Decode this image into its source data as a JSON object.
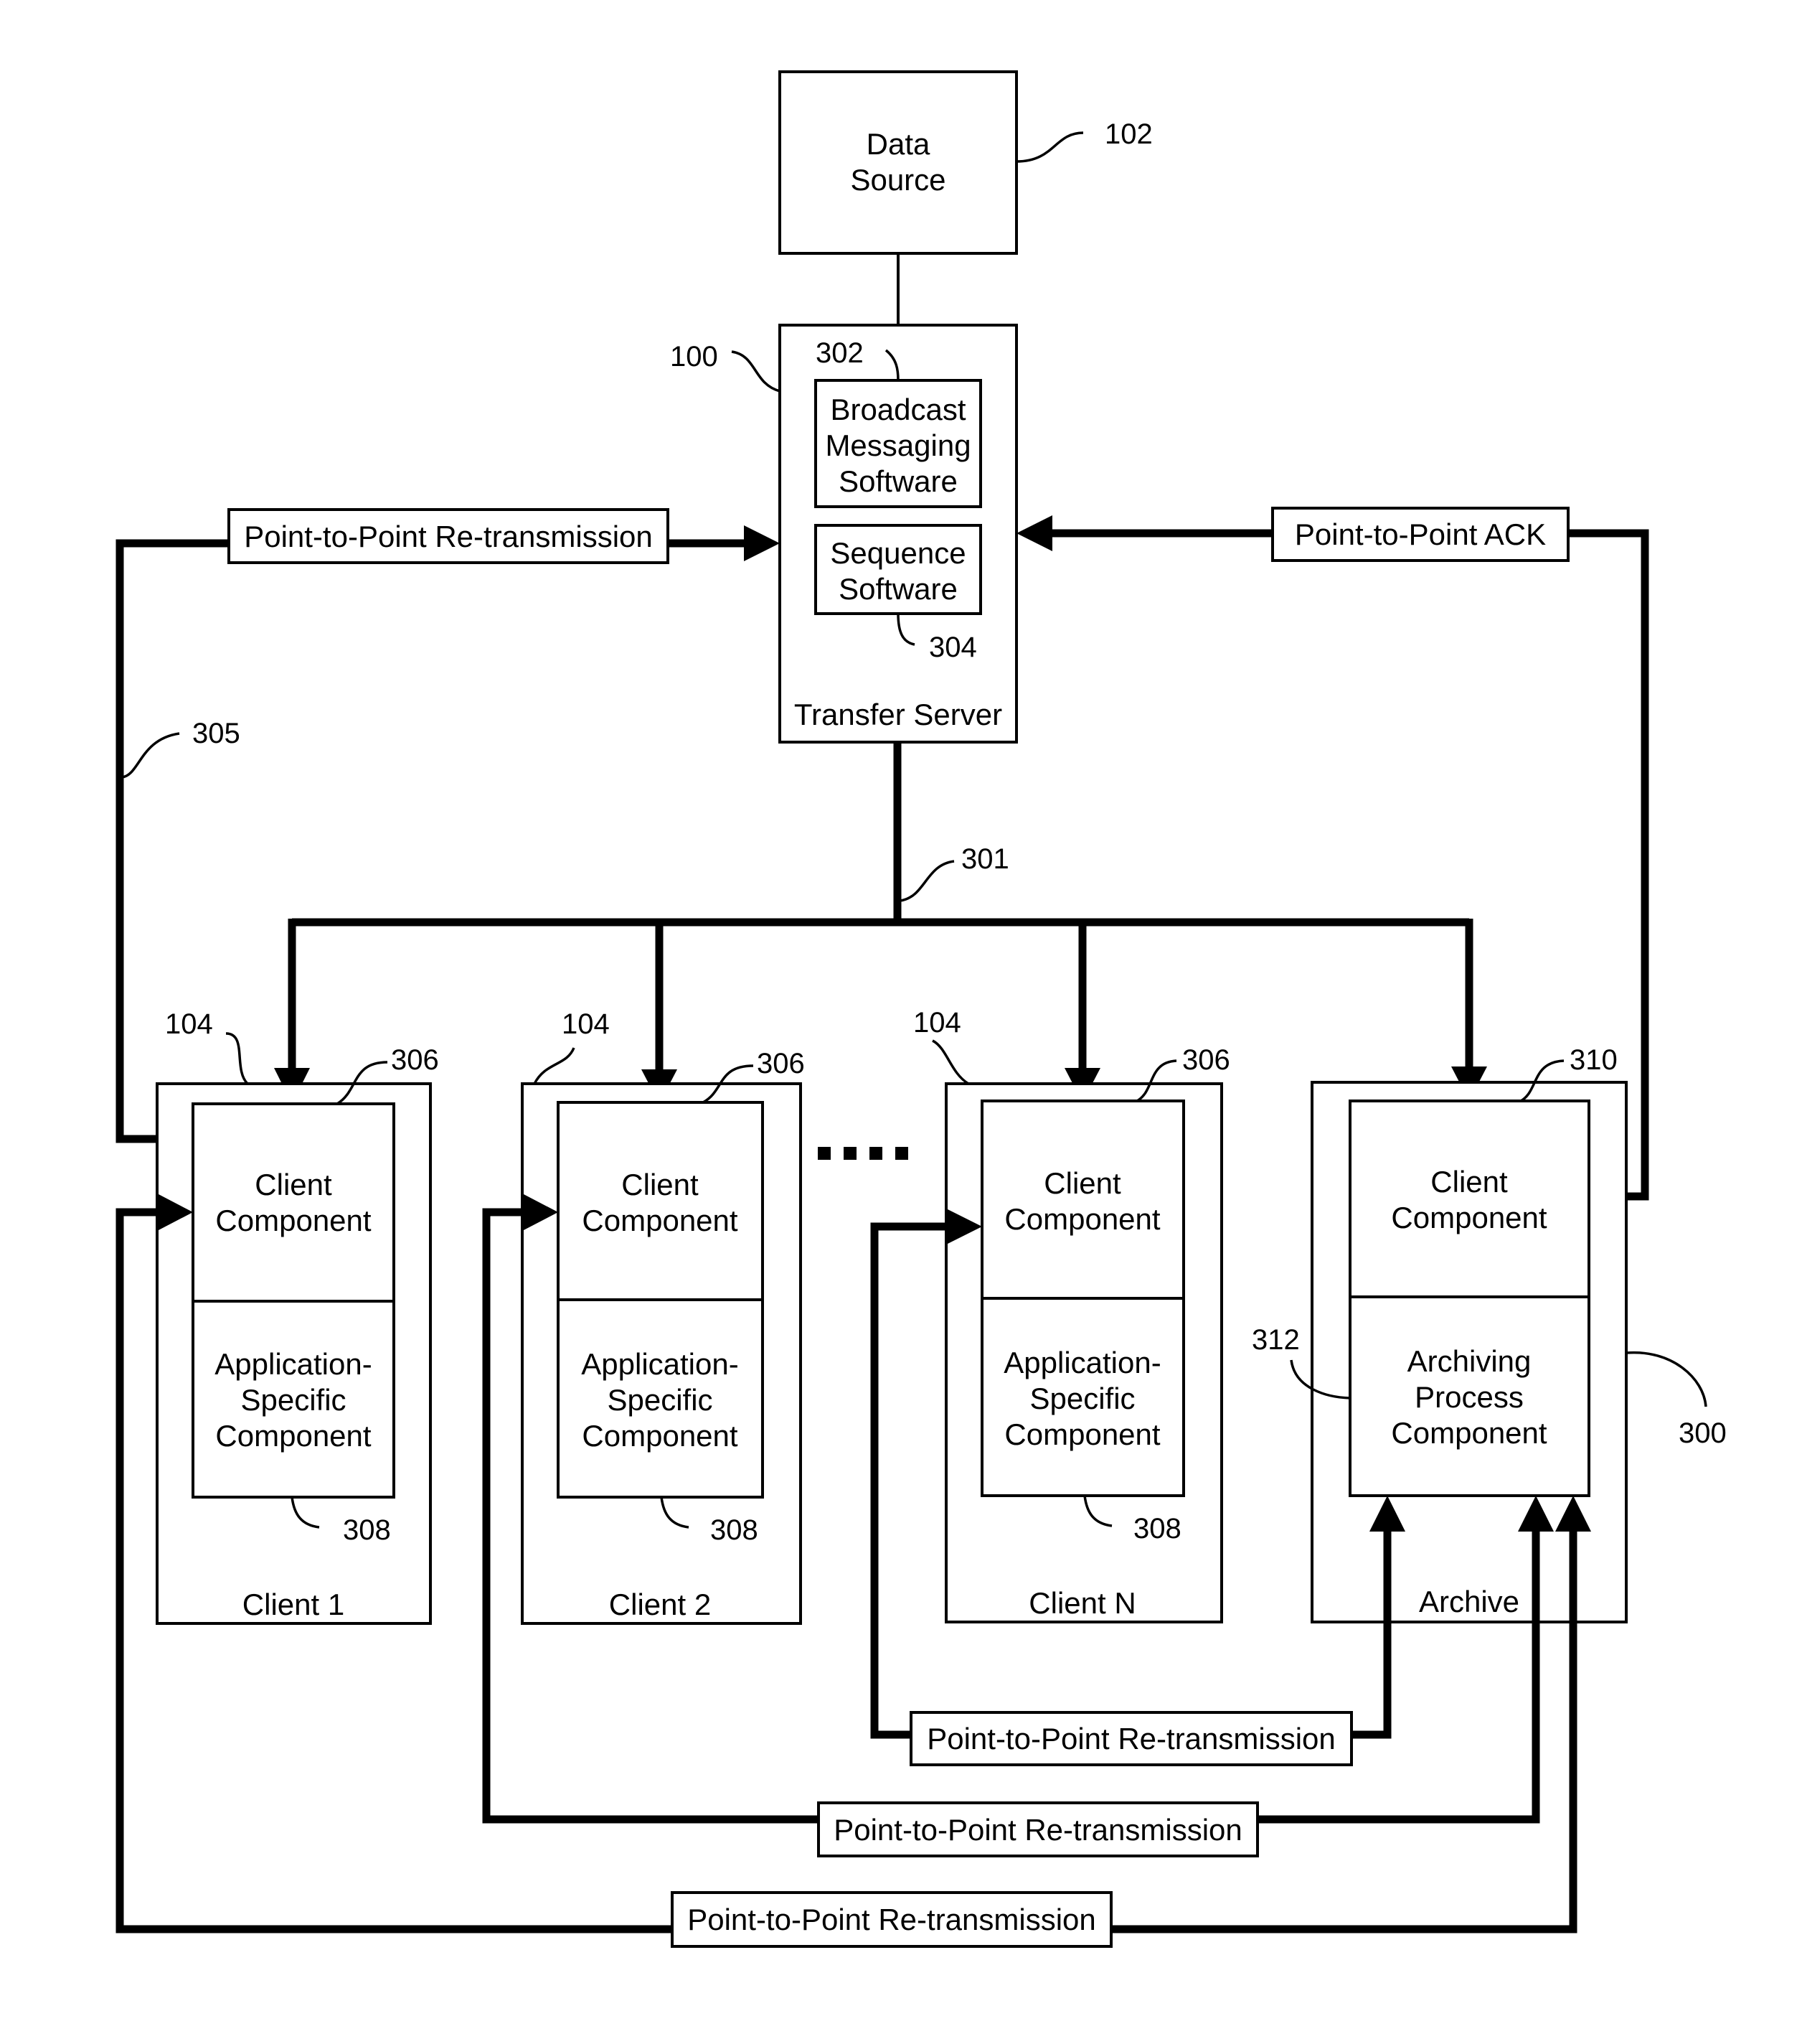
{
  "diagram": {
    "data_source": {
      "lines": [
        "Data",
        "Source"
      ],
      "ref": "102"
    },
    "transfer_server": {
      "title": "Transfer Server",
      "ref": "100",
      "broadcast": {
        "lines": [
          "Broadcast",
          "Messaging",
          "Software"
        ],
        "ref": "302"
      },
      "sequence": {
        "lines": [
          "Sequence",
          "Software"
        ],
        "ref": "304"
      }
    },
    "bus_ref": "301",
    "retrans_path_ref": "305",
    "top_retransmission_label": "Point-to-Point Re-transmission",
    "ack_label": "Point-to-Point ACK",
    "ellipsis": "....",
    "clients": [
      {
        "title": "Client 1",
        "ref": "104",
        "upper": [
          "Client",
          "Component"
        ],
        "upper_ref": "306",
        "lower": [
          "Application-",
          "Specific",
          "Component"
        ],
        "lower_ref": "308"
      },
      {
        "title": "Client 2",
        "ref": "104",
        "upper": [
          "Client",
          "Component"
        ],
        "upper_ref": "306",
        "lower": [
          "Application-",
          "Specific",
          "Component"
        ],
        "lower_ref": "308"
      },
      {
        "title": "Client N",
        "ref": "104",
        "upper": [
          "Client",
          "Component"
        ],
        "upper_ref": "306",
        "lower": [
          "Application-",
          "Specific",
          "Component"
        ],
        "lower_ref": "308"
      }
    ],
    "archive": {
      "title": "Archive",
      "ref": "300",
      "upper": [
        "Client",
        "Component"
      ],
      "upper_ref": "310",
      "lower": [
        "Archiving",
        "Process",
        "Component"
      ],
      "lower_ref": "312"
    },
    "bottom_retransmission_labels": [
      "Point-to-Point Re-transmission",
      "Point-to-Point Re-transmission",
      "Point-to-Point Re-transmission"
    ]
  }
}
